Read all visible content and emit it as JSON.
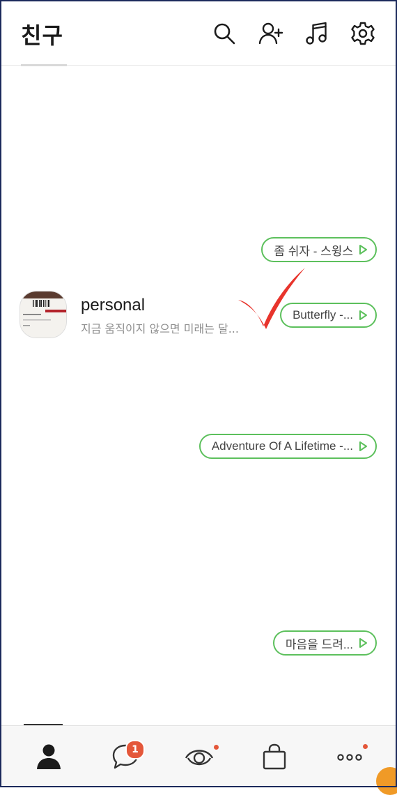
{
  "header": {
    "title": "친구"
  },
  "music": [
    {
      "label": "좀 쉬자 - 스윙스"
    },
    {
      "label": "Butterfly -..."
    },
    {
      "label": "Adventure Of A Lifetime -..."
    },
    {
      "label": "마음을 드려..."
    }
  ],
  "friend": {
    "name": "personal",
    "status": "지금 움직이지 않으면 미래는 달..."
  },
  "tabs": {
    "chats_badge": "1",
    "items": [
      "person-icon",
      "chat-bubble-icon",
      "eye-icon",
      "shopping-bag-icon",
      "more-dots-icon"
    ]
  },
  "colors": {
    "accent_green": "#5cc05c",
    "badge_red": "#e4573a",
    "check_red": "#e8342c"
  }
}
